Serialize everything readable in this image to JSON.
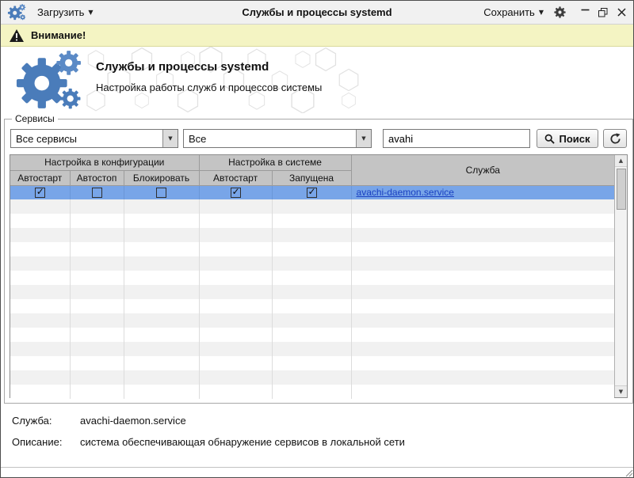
{
  "titlebar": {
    "load_label": "Загрузить",
    "title": "Службы и процессы systemd",
    "save_label": "Сохранить"
  },
  "warning": {
    "text": "Внимание!"
  },
  "banner": {
    "title": "Службы и процессы systemd",
    "subtitle": "Настройка работы служб и процессов системы"
  },
  "filters": {
    "legend": "Сервисы",
    "service_filter_value": "Все сервисы",
    "state_filter_value": "Все",
    "search_value": "avahi",
    "search_button_label": "Поиск"
  },
  "table": {
    "group_headers": {
      "config": "Настройка в конфигурации",
      "system": "Настройка в системе",
      "service": "Служба"
    },
    "columns": {
      "autostart_config": "Автостарт",
      "autostop": "Автостоп",
      "block": "Блокировать",
      "autostart_system": "Автостарт",
      "running": "Запущена"
    },
    "rows": [
      {
        "autostart_config": true,
        "autostop": false,
        "block": false,
        "autostart_system": true,
        "running": true,
        "service": "avachi-daemon.service",
        "selected": true
      }
    ]
  },
  "details": {
    "service_label": "Служба:",
    "service_value": "avachi-daemon.service",
    "description_label": "Описание:",
    "description_value": "система обеспечивающая обнаружение сервисов в локальной сети"
  },
  "icons": {
    "app_logo": "gears",
    "warning": "exclamation-triangle",
    "search": "magnifier",
    "refresh": "circular-arrows",
    "settings": "gear",
    "dropdown_caret": "▼",
    "combo_arrow": "▼",
    "scroll_up": "▲",
    "scroll_down": "▼"
  },
  "colors": {
    "selection": "#78a5e8",
    "accent_blue": "#4a7cba",
    "warning_bg": "#f4f4c3",
    "link": "#1a41c2"
  }
}
